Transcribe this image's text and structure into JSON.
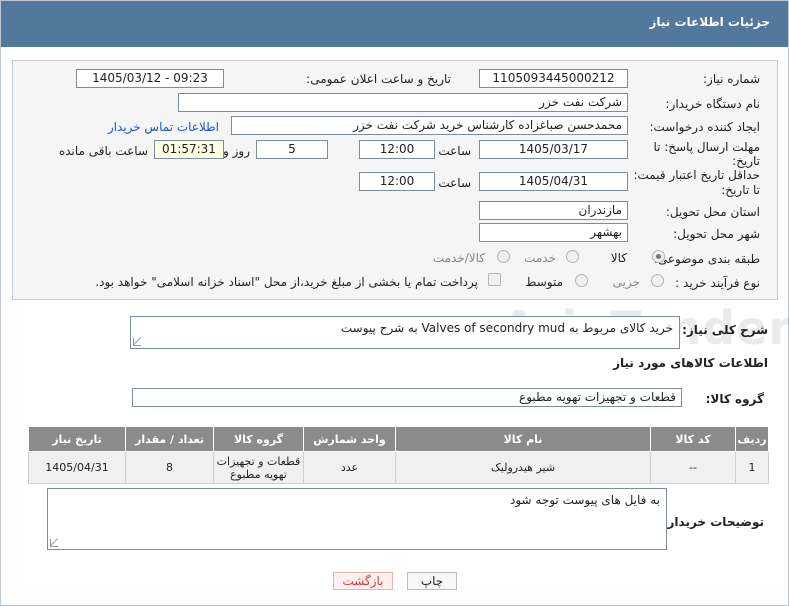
{
  "header": {
    "title": "جزئیات اطلاعات نیاز"
  },
  "form": {
    "need_number_label": "شماره نیاز:",
    "need_number": "1105093445000212",
    "announce_label": "تاریخ و ساعت اعلان عمومی:",
    "announce_value": "1405/03/12 - 09:23",
    "buyer_org_label": "نام دستگاه خریدار:",
    "buyer_org": "شرکت نفت خزر",
    "creator_label": "ایجاد کننده درخواست:",
    "creator": "محمدحسن صباغزاده کارشناس خرید شرکت نفت خزر",
    "contact_link": "اطلاعات تماس خریدار",
    "deadline_label_1": "مهلت ارسال پاسخ: تا",
    "deadline_label_2": "تاریخ:",
    "deadline_date": "1405/03/17",
    "time_label": "ساعت",
    "deadline_time": "12:00",
    "days_value": "5",
    "days_label": "روز و",
    "remaining_value": "01:57:31",
    "remaining_label": "ساعت باقی مانده",
    "validity_label_1": "حداقل تاریخ اعتبار قیمت:",
    "validity_label_2": "تا تاریخ:",
    "validity_date": "1405/04/31",
    "validity_time_label": "ساعت",
    "validity_time": "12:00",
    "province_label": "استان محل تحویل:",
    "province": "مازندران",
    "city_label": "شهر محل تحویل:",
    "city": "بهشهر",
    "category_label": "طبقه بندی موضوعی:",
    "category_options": [
      "کالا",
      "خدمت",
      "کالا/خدمت"
    ],
    "category_selected": "کالا",
    "process_label": "نوع فرآیند خرید :",
    "process_options": [
      "جزیی",
      "متوسط"
    ],
    "payment_note": "پرداخت تمام یا بخشی از مبلغ خرید،از محل \"اسناد خزانه اسلامی\" خواهد بود."
  },
  "summary": {
    "label": "شرح کلی نیاز:",
    "value": "خرید کالای مربوط به Valves of secondry mud به شرح پیوست"
  },
  "goods": {
    "section_title": "اطلاعات کالاهای مورد نیاز",
    "group_label": "گروه کالا:",
    "group_value": "قطعات و تجهیزات تهویه مطبوع",
    "columns": [
      "ردیف",
      "کد کالا",
      "نام کالا",
      "واحد شمارش",
      "گروه کالا",
      "تعداد / مقدار",
      "تاریخ نیاز"
    ],
    "rows": [
      {
        "row": "1",
        "code": "--",
        "name": "شیر هیدرولیک",
        "unit": "عدد",
        "group": "قطعات و تجهیزات تهویه مطبوع",
        "qty": "8",
        "date": "1405/04/31"
      }
    ]
  },
  "buyer_notes": {
    "label": "توضیحات خریدار:",
    "value": "به فایل های پیوست توجه شود"
  },
  "buttons": {
    "print": "چاپ",
    "back": "بازگشت"
  },
  "watermark": {
    "text": "AriaTender.net"
  }
}
